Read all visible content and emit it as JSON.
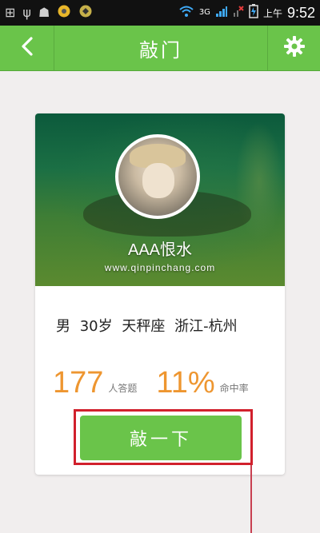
{
  "status_bar": {
    "network_label": "3G",
    "ampm": "上午",
    "time": "9:52"
  },
  "header": {
    "title": "敲门"
  },
  "profile_card": {
    "username": "AAA恨水",
    "watermark": "www.qinpinchang.com",
    "gender": "男",
    "age": "30岁",
    "zodiac": "天秤座",
    "location": "浙江-杭州",
    "answers_count": "177",
    "answers_label": "人答题",
    "hit_rate": "11%",
    "hit_rate_label": "命中率",
    "knock_button": "敲一下"
  },
  "colors": {
    "accent_green": "#6ac44a",
    "stat_orange": "#ee9630",
    "highlight_red": "#d1202c"
  }
}
